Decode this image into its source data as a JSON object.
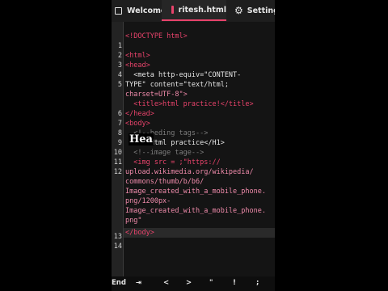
{
  "tabs": [
    {
      "label": "Welcome",
      "icon": "file-icon"
    },
    {
      "label": "ritesh.html",
      "icon": "html-file-icon",
      "active": true
    },
    {
      "label": "Settings",
      "icon": "gear-icon"
    }
  ],
  "editor": {
    "line_numbers": [
      "1",
      "2",
      "3",
      "4",
      "5",
      "6",
      "7",
      "8",
      "9",
      "10",
      "11",
      "12",
      "13",
      "14"
    ],
    "current_line": "13",
    "lines": [
      "<!DOCTYPE html>",
      "",
      "<html>",
      "<head>",
      "  <meta http-equiv=\"CONTENT-",
      "TYPE\" content=\"text/html;",
      "charset=UTF-8\">",
      "  <title>html practice!</title>",
      "</head>",
      "<body>",
      "  <!--heding tags-->",
      "  <H1>Html practice</H1>",
      "  <!--image tage-->",
      "  <img src = ;\"https://",
      "upload.wikimedia.org/wikipedia/",
      "commons/thumb/b/b6/",
      "Image_created_with_a_mobile_phone.",
      "png/1200px-",
      "Image_created_with_a_mobile_phone.",
      "png\"",
      "</body>"
    ]
  },
  "overlay_caption": "Hea",
  "keyboard_bar": {
    "keys": [
      "End",
      "⇥",
      "<",
      ">",
      "\"",
      "!",
      ";"
    ]
  },
  "colors": {
    "tag": "#e8436b",
    "string": "#f08bab",
    "comment": "#7c7c7c",
    "text": "#e6e6e6",
    "background": "#141414"
  }
}
